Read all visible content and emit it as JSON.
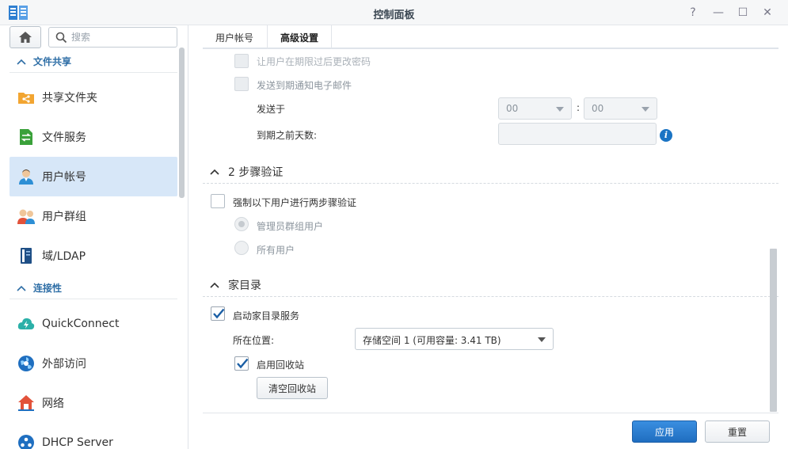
{
  "window": {
    "title": "控制面板",
    "help": "?",
    "minimize": "—",
    "maximize": "☐",
    "close": "✕"
  },
  "sidebar": {
    "search_placeholder": "搜索",
    "sections": [
      {
        "label": "文件共享"
      },
      {
        "label": "连接性"
      }
    ],
    "items": [
      {
        "label": "共享文件夹",
        "icon": "shared-folder-icon",
        "active": false
      },
      {
        "label": "文件服务",
        "icon": "file-services-icon",
        "active": false
      },
      {
        "label": "用户帐号",
        "icon": "user-icon",
        "active": true
      },
      {
        "label": "用户群组",
        "icon": "group-icon",
        "active": false
      },
      {
        "label": "域/LDAP",
        "icon": "domain-ldap-icon",
        "active": false
      },
      {
        "label": "QuickConnect",
        "icon": "quickconnect-icon",
        "active": false
      },
      {
        "label": "外部访问",
        "icon": "external-access-icon",
        "active": false
      },
      {
        "label": "网络",
        "icon": "network-icon",
        "active": false
      },
      {
        "label": "DHCP Server",
        "icon": "dhcp-server-icon",
        "active": false
      }
    ]
  },
  "tabs": [
    {
      "label": "用户帐号",
      "active": false
    },
    {
      "label": "高级设置",
      "active": true
    }
  ],
  "password_expiry": {
    "cut_off_label": "让用户在期限过后更改密码",
    "send_email_label": "发送到期通知电子邮件",
    "send_at_label": "发送于",
    "hour_value": "00",
    "colon": ":",
    "minute_value": "00",
    "days_before_label": "到期之前天数:",
    "days_before_value": "",
    "info_icon_text": "i"
  },
  "two_step": {
    "title": "2 步骤验证",
    "enforce_label": "强制以下用户进行两步骤验证",
    "admin_label": "管理员群组用户",
    "all_label": "所有用户"
  },
  "home": {
    "title": "家目录",
    "enable_label": "启动家目录服务",
    "location_label": "所在位置:",
    "location_value": "存储空间 1 (可用容量:  3.41 TB)",
    "recycle_label": "启用回收站",
    "empty_recycle_button": "清空回收站"
  },
  "footer": {
    "apply": "应用",
    "reset": "重置"
  },
  "colors": {
    "accent": "#2e6ea6",
    "active_bg": "#d7e7f8",
    "primary_button": "#1f6ec0"
  }
}
